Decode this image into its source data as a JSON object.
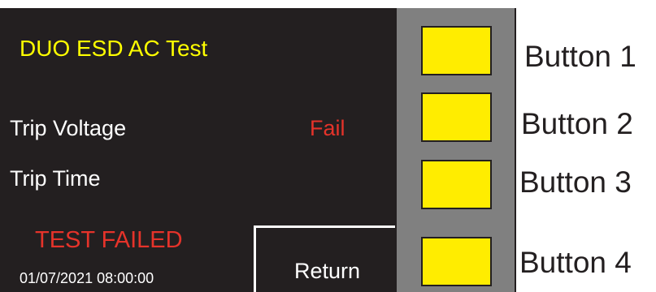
{
  "screen": {
    "title": "DUO ESD AC Test",
    "rows": [
      {
        "label": "Trip Voltage",
        "result": "Fail"
      },
      {
        "label": "Trip Time",
        "result": ""
      }
    ],
    "status": "TEST FAILED",
    "datetime": "01/07/2021  08:00:00",
    "return_label": "Return"
  },
  "side_panel": {
    "callouts": [
      "Button 1",
      "Button 2",
      "Button 3",
      "Button 4"
    ]
  },
  "colors": {
    "screen_bg": "#231f20",
    "title": "#ffff00",
    "fail": "#e5332a",
    "panel": "#808080",
    "soft_key": "#ffed00"
  }
}
